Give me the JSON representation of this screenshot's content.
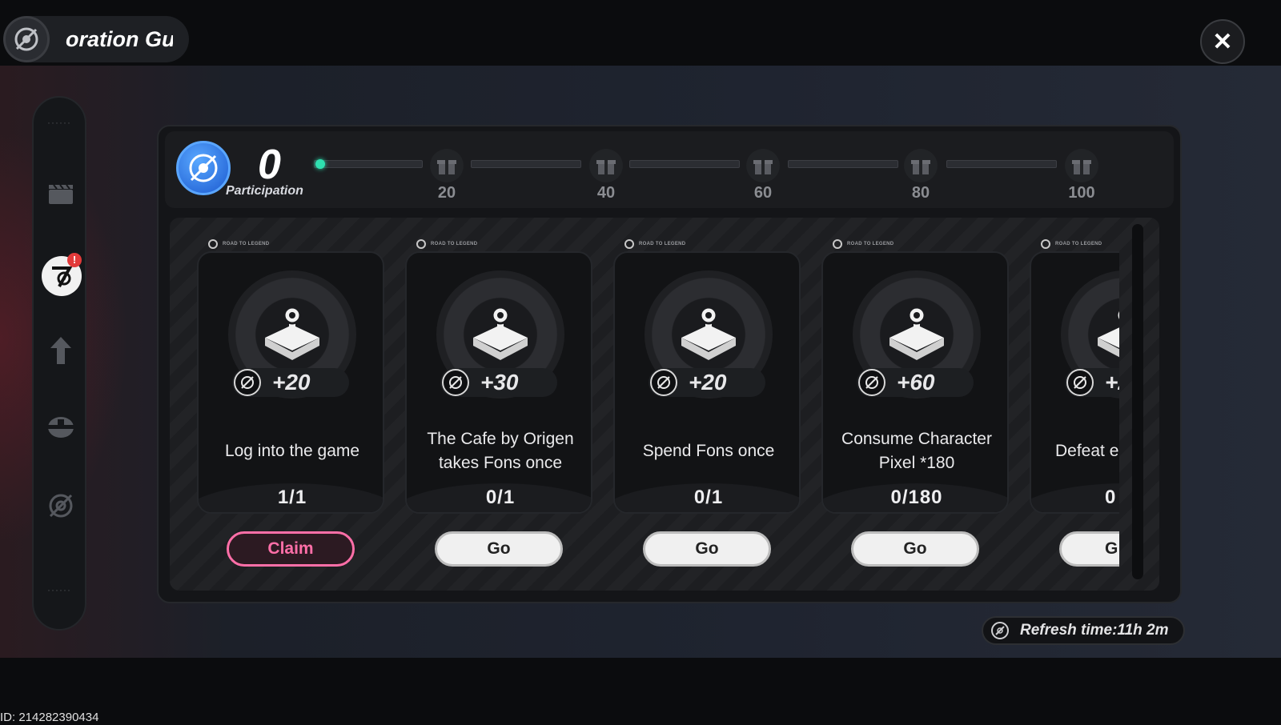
{
  "window": {
    "title": "oration Gu",
    "close_icon": "close-icon"
  },
  "sidebar": {
    "items": [
      {
        "icon": "clapperboard-icon",
        "active": false
      },
      {
        "icon": "exploration-guide-icon",
        "active": true,
        "badge": "!"
      },
      {
        "icon": "arrow-up-icon",
        "active": false
      },
      {
        "icon": "controller-icon",
        "active": false
      },
      {
        "icon": "compass-off-icon",
        "active": false
      }
    ]
  },
  "participation": {
    "value": "0",
    "label": "Participation",
    "progress_fraction": 0,
    "milestones": [
      "20",
      "40",
      "60",
      "80",
      "100"
    ]
  },
  "tasks": [
    {
      "header": "ROAD TO LEGEND",
      "reward": "+20",
      "name": "Log into the game",
      "progress": "1/1",
      "action": "Claim",
      "state": "claim"
    },
    {
      "header": "ROAD TO LEGEND",
      "reward": "+30",
      "name": "The Cafe by Origen takes Fons once",
      "progress": "0/1",
      "action": "Go",
      "state": "go"
    },
    {
      "header": "ROAD TO LEGEND",
      "reward": "+20",
      "name": "Spend Fons once",
      "progress": "0/1",
      "action": "Go",
      "state": "go"
    },
    {
      "header": "ROAD TO LEGEND",
      "reward": "+60",
      "name": "Consume Character Pixel *180",
      "progress": "0/180",
      "action": "Go",
      "state": "go"
    },
    {
      "header": "ROAD TO LEGEND",
      "reward": "+2",
      "name": "Defeat e",
      "progress": "0",
      "action": "G",
      "state": "go"
    }
  ],
  "refresh": {
    "text": "Refresh time:11h 2m"
  },
  "footer": {
    "uid": "ID: 214282390434"
  },
  "colors": {
    "accent_pink": "#ff6fa8",
    "progress_dot": "#2fe0b0",
    "participation_blue": "#1c5ad0",
    "badge_red": "#e23a3a"
  }
}
